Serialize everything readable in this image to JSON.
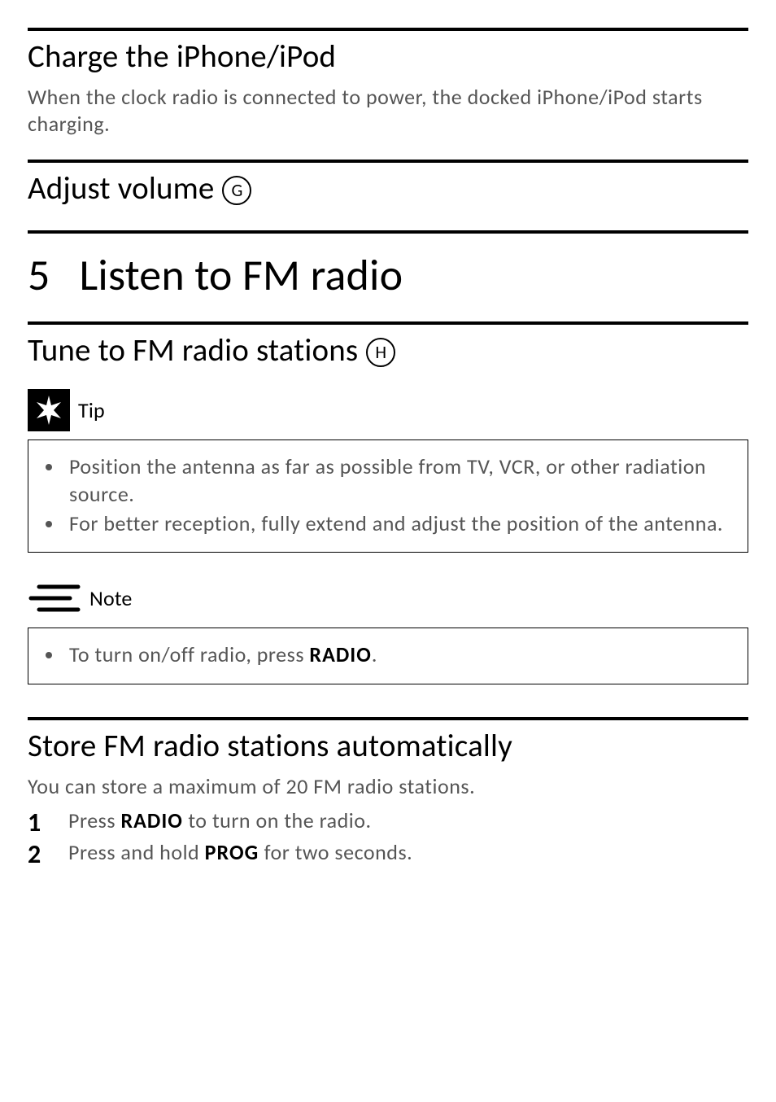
{
  "s1": {
    "title": "Charge the iPhone/iPod",
    "body": "When the clock radio is connected to power, the docked iPhone/iPod starts charging."
  },
  "s2": {
    "title": "Adjust volume",
    "ref": "G"
  },
  "ch": {
    "num": "5",
    "title": "Listen to FM radio"
  },
  "s3": {
    "title": "Tune to FM radio stations",
    "ref": "H"
  },
  "tip": {
    "label": "Tip",
    "items": [
      "Position the antenna as far as possible from TV, VCR, or other radiation source.",
      "For better reception, fully extend and adjust the position of the antenna."
    ]
  },
  "note": {
    "label": "Note",
    "item_pre": "To turn on/off radio, press ",
    "item_kw": "RADIO",
    "item_post": "."
  },
  "s4": {
    "title": "Store FM radio stations automatically",
    "intro": "You can store a maximum of 20 FM radio stations.",
    "steps": [
      {
        "pre": "Press ",
        "kw": "RADIO",
        "post": " to turn on the radio."
      },
      {
        "pre": "Press and hold ",
        "kw": "PROG",
        "post": " for two seconds."
      }
    ]
  }
}
